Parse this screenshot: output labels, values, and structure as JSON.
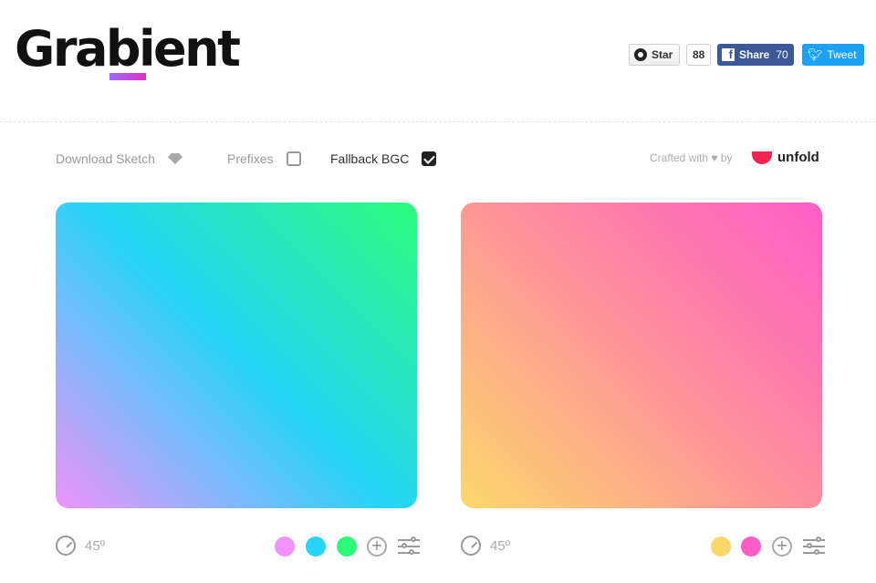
{
  "header": {
    "logo_text": "Grabient",
    "github": {
      "label": "Star",
      "count": "88"
    },
    "facebook": {
      "label": "Share",
      "count": "70"
    },
    "twitter": {
      "label": "Tweet"
    }
  },
  "options": {
    "download_label": "Download Sketch",
    "prefixes_label": "Prefixes",
    "prefixes_checked": false,
    "fallback_label": "Fallback BGC",
    "fallback_checked": true
  },
  "credit": {
    "crafted_label": "Crafted with ♥ by",
    "brand": "unfold"
  },
  "gradients": [
    {
      "angle": "45º",
      "stops": [
        "#f093fb",
        "#27d5f9",
        "#2afc79"
      ]
    },
    {
      "angle": "45º",
      "stops": [
        "#fcd86b",
        "#fe5dc8"
      ]
    }
  ],
  "colors": {
    "logo_underline_start": "#a06bf5",
    "logo_underline_end": "#e12fc9",
    "facebook": "#3b5998",
    "twitter": "#1da1f2",
    "unfold": "#f0244f"
  }
}
